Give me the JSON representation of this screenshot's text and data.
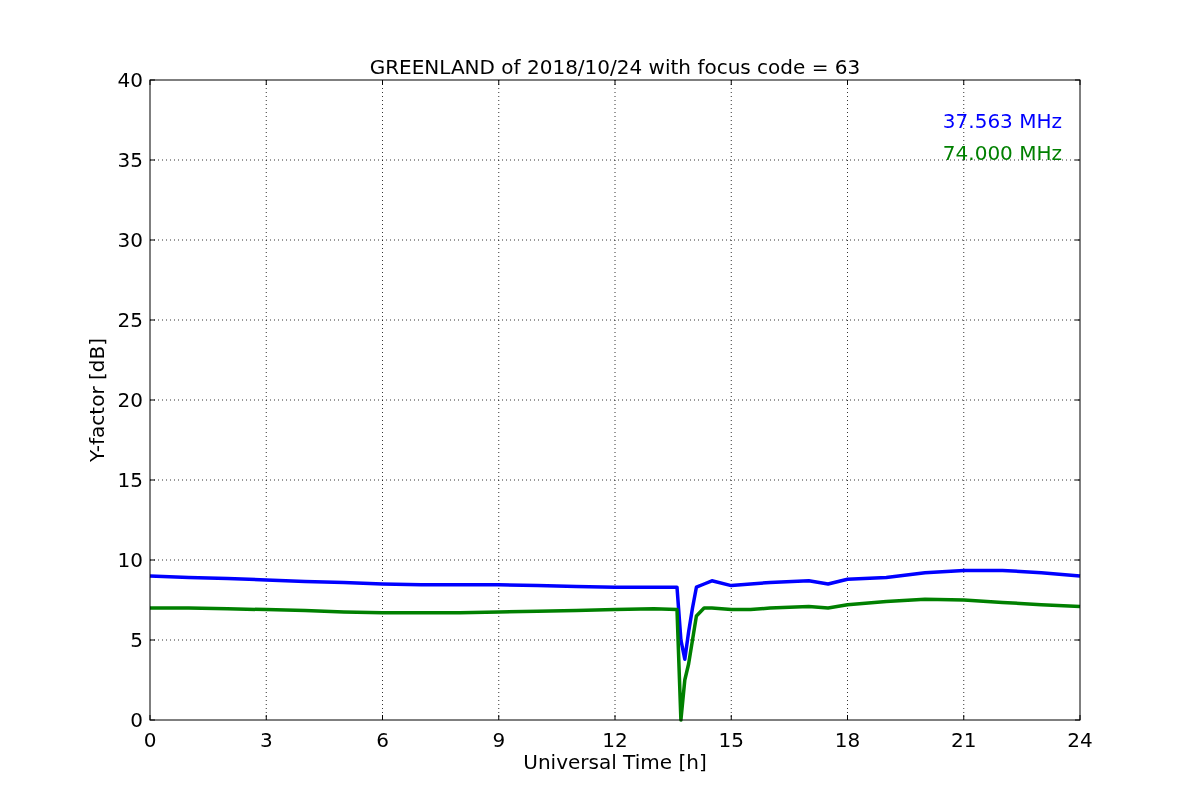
{
  "figure": {
    "chart_data": {
      "type": "line",
      "title": "GREENLAND of 2018/10/24 with focus code = 63",
      "xlabel": "Universal Time [h]",
      "ylabel": "Y-factor [dB]",
      "x": [
        0,
        1,
        2,
        3,
        4,
        5,
        6,
        7,
        8,
        9,
        10,
        11,
        12,
        13,
        13.6,
        13.7,
        13.8,
        13.9,
        14.0,
        14.1,
        14.3,
        14.5,
        15,
        15.5,
        16,
        17,
        17.5,
        18,
        19,
        20,
        21,
        22,
        23,
        24
      ],
      "series": [
        {
          "name": "37.563 MHz",
          "color": "#0000ff",
          "values": [
            9.0,
            8.9,
            8.85,
            8.75,
            8.65,
            8.6,
            8.5,
            8.45,
            8.45,
            8.45,
            8.4,
            8.35,
            8.3,
            8.3,
            8.3,
            5,
            3.8,
            5.5,
            7,
            8.3,
            8.5,
            8.7,
            8.4,
            8.5,
            8.6,
            8.7,
            8.5,
            8.8,
            8.9,
            9.2,
            9.35,
            9.35,
            9.2,
            9.0
          ]
        },
        {
          "name": "74.000 MHz",
          "color": "#008000",
          "values": [
            7.0,
            7.0,
            6.95,
            6.9,
            6.85,
            6.75,
            6.7,
            6.7,
            6.7,
            6.75,
            6.8,
            6.85,
            6.9,
            6.95,
            6.9,
            0,
            2.5,
            3.5,
            5,
            6.5,
            7.0,
            7.0,
            6.9,
            6.9,
            7.0,
            7.1,
            7.0,
            7.2,
            7.4,
            7.55,
            7.5,
            7.35,
            7.2,
            7.1
          ]
        }
      ],
      "grid": true,
      "xlim": [
        0,
        24
      ],
      "ylim": [
        0,
        40
      ],
      "xticks": [
        0,
        3,
        6,
        9,
        12,
        15,
        18,
        21,
        24
      ],
      "yticks": [
        0,
        5,
        10,
        15,
        20,
        25,
        30,
        35,
        40
      ]
    }
  }
}
